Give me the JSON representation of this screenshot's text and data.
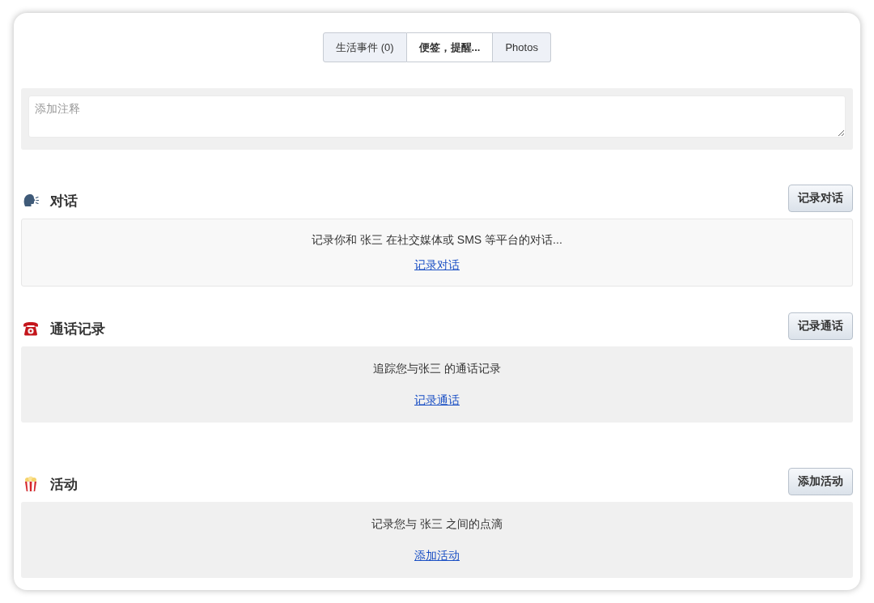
{
  "tabs": [
    {
      "label": "生活事件 (0)",
      "selected": false
    },
    {
      "label": "便签，提醒...",
      "selected": true
    },
    {
      "label": "Photos",
      "selected": false
    }
  ],
  "note_field": {
    "placeholder": "添加注释"
  },
  "sections": [
    {
      "kind": "conversations",
      "title": "对话",
      "button": "记录对话",
      "description": "记录你和 张三 在社交媒体或 SMS 等平台的对话...",
      "link": "记录对话"
    },
    {
      "kind": "calls",
      "title": "通话记录",
      "button": "记录通话",
      "description": "追踪您与张三 的通话记录",
      "link": "记录通话"
    },
    {
      "kind": "activities",
      "title": "活动",
      "button": "添加活动",
      "description": "记录您与 张三 之间的点滴",
      "link": "添加活动"
    }
  ]
}
